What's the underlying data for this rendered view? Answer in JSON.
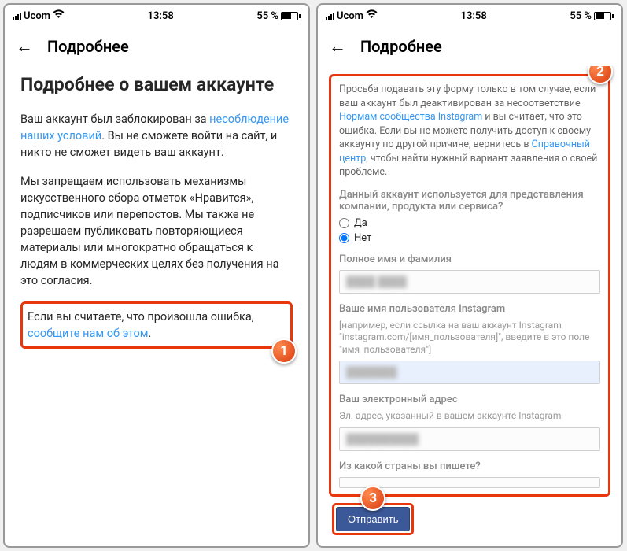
{
  "status": {
    "carrier": "Ucom",
    "time": "13:58",
    "battery_pct": "55 %"
  },
  "header": {
    "title": "Подробнее"
  },
  "left": {
    "heading": "Подробнее о вашем аккаунте",
    "p1_pre": "Ваш аккаунт был заблокирован за ",
    "p1_link": "несоблюдение наших условий",
    "p1_post": ". Вы не сможете войти на сайт, и никто не сможет видеть ваш аккаунт.",
    "p2": "Мы запрещаем использовать механизмы искусственного сбора отметок «Нравится», подписчиков или перепостов. Мы также не разрешаем публиковать повторяющиеся материалы или многократно обращаться к людям в коммерческих целях без получения на это согласия.",
    "p3_pre": "Если вы считаете, что произошла ошибка, ",
    "p3_link": "сообщите нам об этом",
    "p3_post": "."
  },
  "right": {
    "intro_pre": "Просьба подавать эту форму только в том случае, если ваш аккаунт был деактивирован за несоответствие ",
    "intro_link1": "Нормам сообщества Instagram",
    "intro_mid": " и вы считает, что это ошибка. Если вы не можете получить доступ к своему аккаунту по другой причине, вернитесь в ",
    "intro_link2": "Справочный центр",
    "intro_post": ", чтобы найти нужный вариант заявления о своей проблеме.",
    "q_company": "Данный аккаунт используется для представления компании, продукта или сервиса?",
    "opt_yes": "Да",
    "opt_no": "Нет",
    "label_fullname": "Полное имя и фамилия",
    "label_username": "Ваше имя пользователя Instagram",
    "hint_username": "[например, если ссылка на ваш аккаунт Instagram \"instagram.com/[имя_пользователя]\", введите в это поле \"имя_пользователя\"]",
    "label_email": "Ваш электронный адрес",
    "hint_email": "Эл. адрес, указанный в вашем аккаунте Instagram",
    "label_country": "Из какой страны вы пишете?",
    "submit": "Отправить"
  },
  "markers": {
    "m1": "1",
    "m2": "2",
    "m3": "3"
  }
}
